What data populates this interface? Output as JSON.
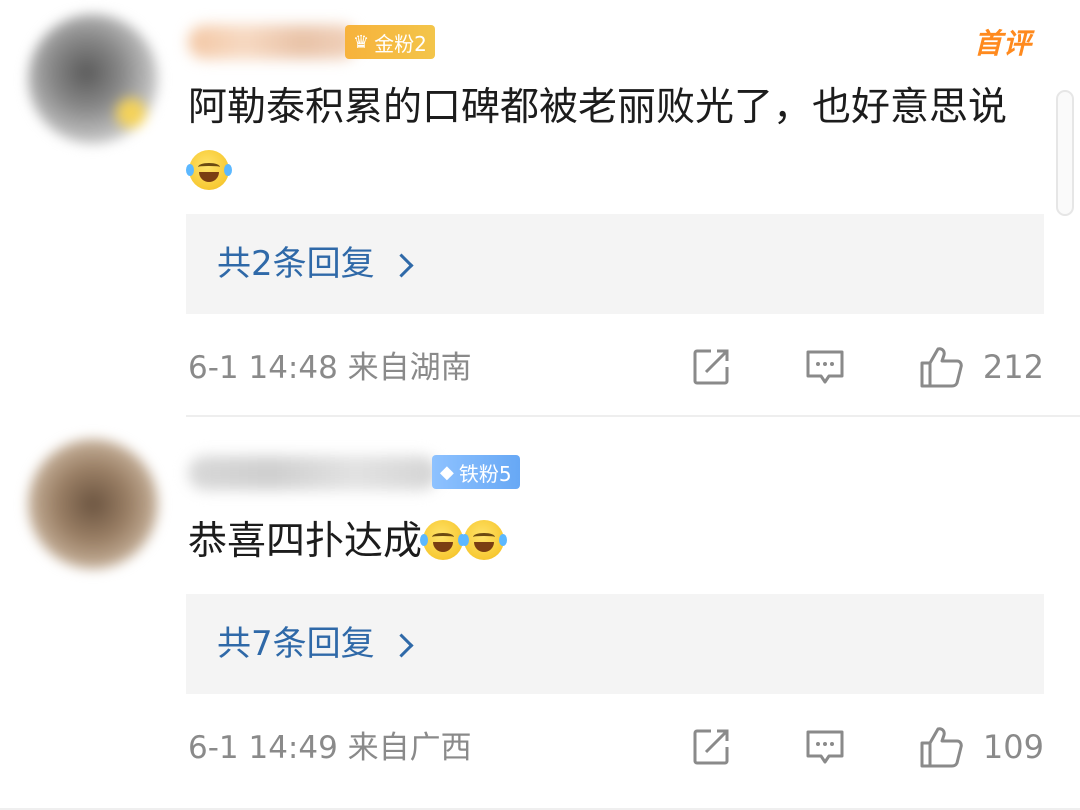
{
  "comments": [
    {
      "badge_label": "金粉2",
      "first_label": "首评",
      "text": "阿勒泰积累的口碑都被老丽败光了，也好意思说",
      "replies_label": "共2条回复",
      "meta": "6-1 14:48 来自湖南",
      "likes": "212"
    },
    {
      "badge_label": "铁粉5",
      "text": "恭喜四扑达成",
      "replies_label": "共7条回复",
      "meta": "6-1 14:49 来自广西",
      "likes": "109"
    }
  ],
  "icons": {
    "share": "share-icon",
    "comment": "comment-icon",
    "like": "thumbs-up-icon",
    "emoji_first": "crying-laughing-emoji",
    "emoji_second": "laughing-emoji"
  },
  "colors": {
    "link": "#2f69a8",
    "meta": "#8a8a8a",
    "gold_badge": "#f7b23b",
    "iron_badge": "#67a8f5",
    "first_comment": "#ff8a1e",
    "reply_bg": "#f4f4f4"
  }
}
